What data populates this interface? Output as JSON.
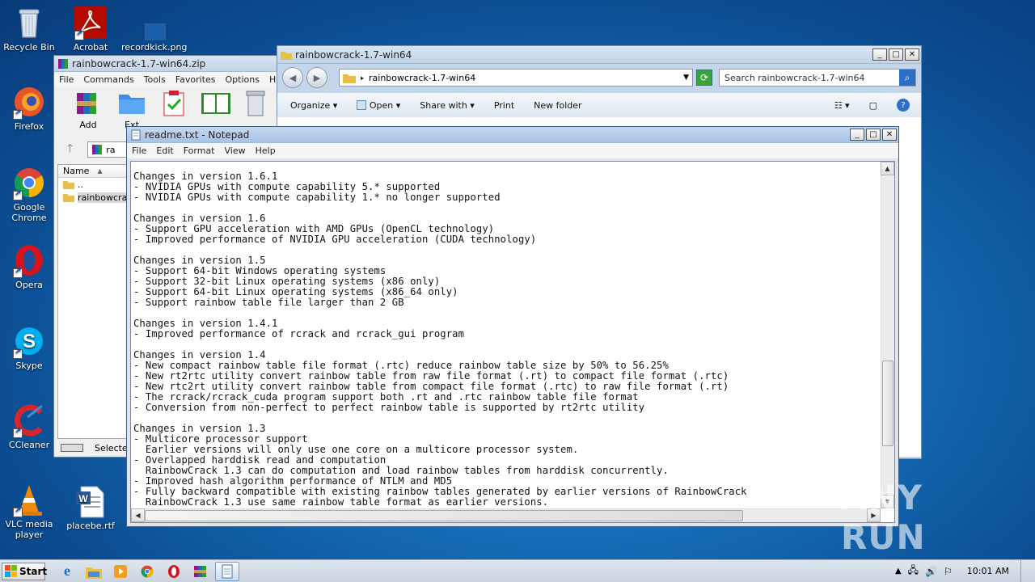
{
  "desktop": {
    "icons": [
      {
        "label": "Recycle Bin"
      },
      {
        "label": "Firefox"
      },
      {
        "label": "Google Chrome"
      },
      {
        "label": "Opera"
      },
      {
        "label": "Skype"
      },
      {
        "label": "CCleaner"
      },
      {
        "label": "VLC media player"
      },
      {
        "label": "Acrobat"
      },
      {
        "label": "recordkick.png"
      },
      {
        "label": "placebe.rtf"
      }
    ]
  },
  "winrar": {
    "title": "rainbowcrack-1.7-win64.zip",
    "menu": [
      "File",
      "Commands",
      "Tools",
      "Favorites",
      "Options",
      "Help"
    ],
    "toolbar": [
      "Add",
      "Ext"
    ],
    "path": "ra",
    "column_name": "Name",
    "rows": [
      "..",
      "rainbowcrack"
    ],
    "status": "Selected"
  },
  "explorer": {
    "title": "rainbowcrack-1.7-win64",
    "address": "rainbowcrack-1.7-win64",
    "search_placeholder": "Search rainbowcrack-1.7-win64",
    "toolbar": {
      "organize": "Organize",
      "open": "Open",
      "share": "Share with",
      "print": "Print",
      "new_folder": "New folder"
    }
  },
  "notepad": {
    "title": "readme.txt - Notepad",
    "menu": [
      "File",
      "Edit",
      "Format",
      "View",
      "Help"
    ],
    "lines": [
      "Changes in version 1.6.1",
      "- NVIDIA GPUs with compute capability 5.* supported",
      "- NVIDIA GPUs with compute capability 1.* no longer supported",
      "",
      "Changes in version 1.6",
      "- Support GPU acceleration with AMD GPUs (OpenCL technology)",
      "- Improved performance of NVIDIA GPU acceleration (CUDA technology)",
      "",
      "Changes in version 1.5",
      "- Support 64-bit Windows operating systems",
      "- Support 32-bit Linux operating systems (x86 only)",
      "- Support 64-bit Linux operating systems (x86_64 only)",
      "- Support rainbow table file larger than 2 GB",
      "",
      "Changes in version 1.4.1",
      "- Improved performance of rcrack and rcrack_gui program",
      "",
      "Changes in version 1.4",
      "- New compact rainbow table file format (.rtc) reduce rainbow table size by 50% to 56.25%",
      "- New rt2rtc utility convert rainbow table from raw file format (.rt) to compact file format (.rtc)",
      "- New rtc2rt utility convert rainbow table from compact file format (.rtc) to raw file format (.rt)",
      "- The rcrack/rcrack_cuda program support both .rt and .rtc rainbow table file format",
      "- Conversion from non-perfect to perfect rainbow table is supported by rt2rtc utility",
      "",
      "Changes in version 1.3",
      "- Multicore processor support",
      "  Earlier versions will only use one core on a multicore processor system.",
      "- Overlapped harddisk read and computation",
      "  RainbowCrack 1.3 can do computation and load rainbow tables from harddisk concurrently.",
      "- Improved hash algorithm performance of NTLM and MD5",
      "- Fully backward compatible with existing rainbow tables generated by earlier versions of RainbowCrack",
      "  RainbowCrack 1.3 use same rainbow table format as earlier versions."
    ]
  },
  "taskbar": {
    "start_label": "Start",
    "clock": "10:01 AM"
  },
  "watermark": "ANY RUN"
}
